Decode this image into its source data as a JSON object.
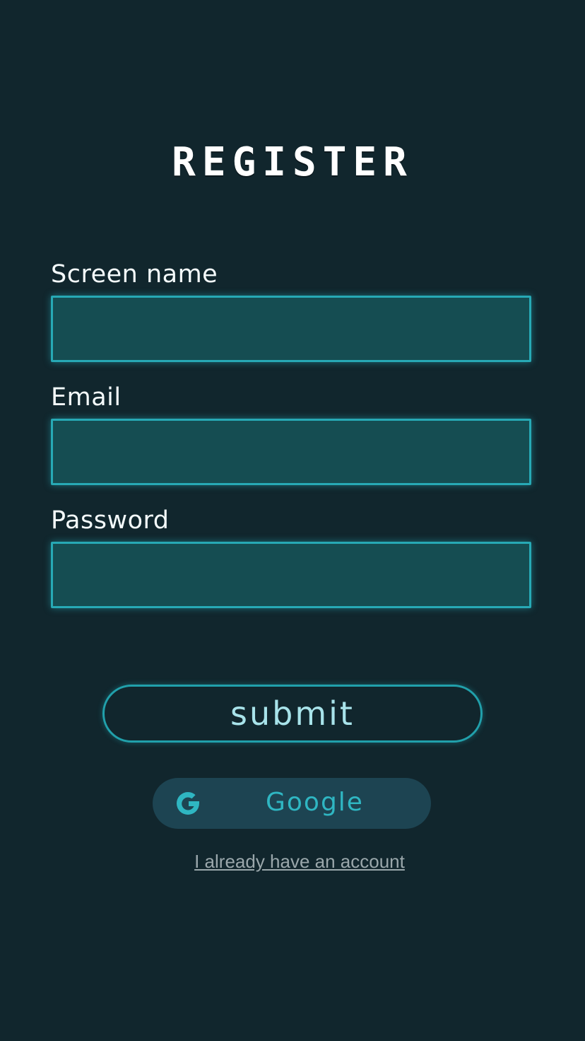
{
  "page": {
    "title": "REGISTER"
  },
  "form": {
    "screen_name": {
      "label": "Screen name",
      "value": "",
      "placeholder": ""
    },
    "email": {
      "label": "Email",
      "value": "",
      "placeholder": ""
    },
    "password": {
      "label": "Password",
      "value": "",
      "placeholder": ""
    }
  },
  "actions": {
    "submit_label": "submit",
    "google_label": "Google",
    "google_icon": "google-g-icon",
    "login_link": "I already have an account"
  },
  "colors": {
    "background": "#11262d",
    "accent": "#27a9b5",
    "input_fill": "#154d52",
    "google_button": "#1d4452",
    "link": "#9aa7ab"
  }
}
